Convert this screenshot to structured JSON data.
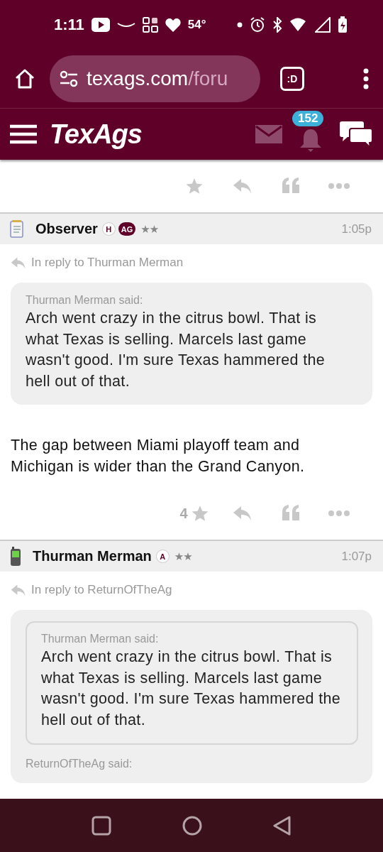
{
  "status_bar": {
    "time": "1:11",
    "temperature": "54°"
  },
  "browser": {
    "url_host": "texags.com",
    "url_path": "/foru",
    "tab_label": ":D"
  },
  "site_header": {
    "logo": "TexAgs",
    "notification_count": "152"
  },
  "posts": [
    {
      "author": "Observer",
      "avatar": {
        "kind": "notepad"
      },
      "badges": [
        {
          "text": "H",
          "kind": "outline"
        },
        {
          "text": "AG",
          "kind": "filled"
        }
      ],
      "rank": "★★",
      "time": "1:05p",
      "reply_to": "In reply to Thurman Merman",
      "quote": {
        "label": "Thurman Merman said:",
        "text": "Arch went crazy in the citrus bowl. That is what Texas is selling. Marcels last game wasn't good. I'm sure Texas hammered the hell out of that."
      },
      "body": "The gap between Miami playoff team and Michigan is wider than the Grand Canyon.",
      "like_count": "4"
    },
    {
      "author": "Thurman Merman",
      "avatar": {
        "kind": "phone"
      },
      "badges": [
        {
          "text": "A",
          "kind": "outline"
        }
      ],
      "rank": "★★",
      "time": "1:07p",
      "reply_to": "In reply to ReturnOfTheAg",
      "quote": {
        "nested": {
          "label": "Thurman Merman said:",
          "text": "Arch went crazy in the citrus bowl. That is what Texas is selling. Marcels last game wasn't good. I'm sure Texas hammered the hell out of that."
        },
        "label": "ReturnOfTheAg said:"
      }
    }
  ]
}
